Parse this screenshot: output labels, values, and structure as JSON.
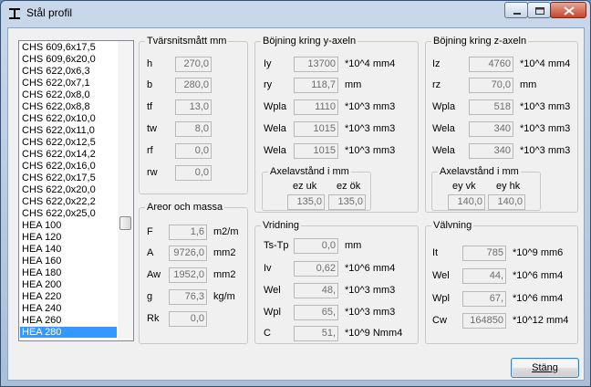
{
  "window": {
    "title": "Stål profil"
  },
  "profile_list": [
    "CHS 609,6x17,5",
    "CHS 609,6x20,0",
    "CHS 622,0x6,3",
    "CHS 622,0x7,1",
    "CHS 622,0x8,0",
    "CHS 622,0x8,8",
    "CHS 622,0x10,0",
    "CHS 622,0x11,0",
    "CHS 622,0x12,5",
    "CHS 622,0x14,2",
    "CHS 622,0x16,0",
    "CHS 622,0x17,5",
    "CHS 622,0x20,0",
    "CHS 622,0x22,2",
    "CHS 622,0x25,0",
    "HEA 100",
    "HEA 120",
    "HEA 140",
    "HEA 160",
    "HEA 180",
    "HEA 200",
    "HEA 220",
    "HEA 240",
    "HEA 260",
    "HEA 280"
  ],
  "selected_profile": "HEA 280",
  "cross_section": {
    "title": "Tvärsnitsmått mm",
    "rows": [
      {
        "label": "h",
        "value": "270,0"
      },
      {
        "label": "b",
        "value": "280,0"
      },
      {
        "label": "tf",
        "value": "13,0"
      },
      {
        "label": "tw",
        "value": "8,0"
      },
      {
        "label": "rf",
        "value": "0,0"
      },
      {
        "label": "rw",
        "value": "0,0"
      }
    ]
  },
  "areas": {
    "title": "Areor och massa",
    "rows": [
      {
        "label": "F",
        "value": "1,6",
        "unit": "m2/m"
      },
      {
        "label": "A",
        "value": "9726,0",
        "unit": "mm2"
      },
      {
        "label": "Aw",
        "value": "1952,0",
        "unit": "mm2"
      },
      {
        "label": "g",
        "value": "76,3",
        "unit": "kg/m"
      },
      {
        "label": "Rk",
        "value": "0,0",
        "unit": ""
      }
    ]
  },
  "bending_y": {
    "title": "Böjning kring y-axeln",
    "rows": [
      {
        "label": "Iy",
        "value": "13700",
        "unit": "*10^4 mm4"
      },
      {
        "label": "ry",
        "value": "118,7",
        "unit": "mm"
      },
      {
        "label": "Wpla",
        "value": "1110",
        "unit": "*10^3 mm3"
      },
      {
        "label": "Wela",
        "value": "1015",
        "unit": "*10^3 mm3"
      },
      {
        "label": "Wela",
        "value": "1015",
        "unit": "*10^3 mm3"
      }
    ],
    "dist_title": "Axelavstånd i mm",
    "dist_labels": [
      "ez uk",
      "ez ök"
    ],
    "dist_values": [
      "135,0",
      "135,0"
    ]
  },
  "bending_z": {
    "title": "Böjning kring z-axeln",
    "rows": [
      {
        "label": "Iz",
        "value": "4760",
        "unit": "*10^4 mm4"
      },
      {
        "label": "rz",
        "value": "70,0",
        "unit": "mm"
      },
      {
        "label": "Wpla",
        "value": "518",
        "unit": "*10^3 mm3"
      },
      {
        "label": "Wela",
        "value": "340",
        "unit": "*10^3 mm3"
      },
      {
        "label": "Wela",
        "value": "340",
        "unit": "*10^3 mm3"
      }
    ],
    "dist_title": "Axelavstånd i mm",
    "dist_labels": [
      "ey vk",
      "ey hk"
    ],
    "dist_values": [
      "140,0",
      "140,0"
    ]
  },
  "torsion": {
    "title": "Vridning",
    "rows": [
      {
        "label": "Ts-Tp",
        "value": "0,0",
        "unit": "mm"
      },
      {
        "label": "Iv",
        "value": "0,62",
        "unit": "*10^6 mm4"
      },
      {
        "label": "Wel",
        "value": "48,",
        "unit": "*10^3 mm3"
      },
      {
        "label": "Wpl",
        "value": "65,",
        "unit": "*10^3 mm3"
      },
      {
        "label": "C",
        "value": "51,",
        "unit": "*10^9 Nmm4"
      }
    ]
  },
  "warping": {
    "title": "Välvning",
    "rows": [
      {
        "label": "It",
        "value": "785",
        "unit": "*10^9 mm6"
      },
      {
        "label": "Wel",
        "value": "44,",
        "unit": "*10^6 mm4"
      },
      {
        "label": "Wpl",
        "value": "67,",
        "unit": "*10^6 mm4"
      },
      {
        "label": "Cw",
        "value": "164850",
        "unit": "*10^12 mm4"
      }
    ]
  },
  "buttons": {
    "close": "Stäng"
  }
}
